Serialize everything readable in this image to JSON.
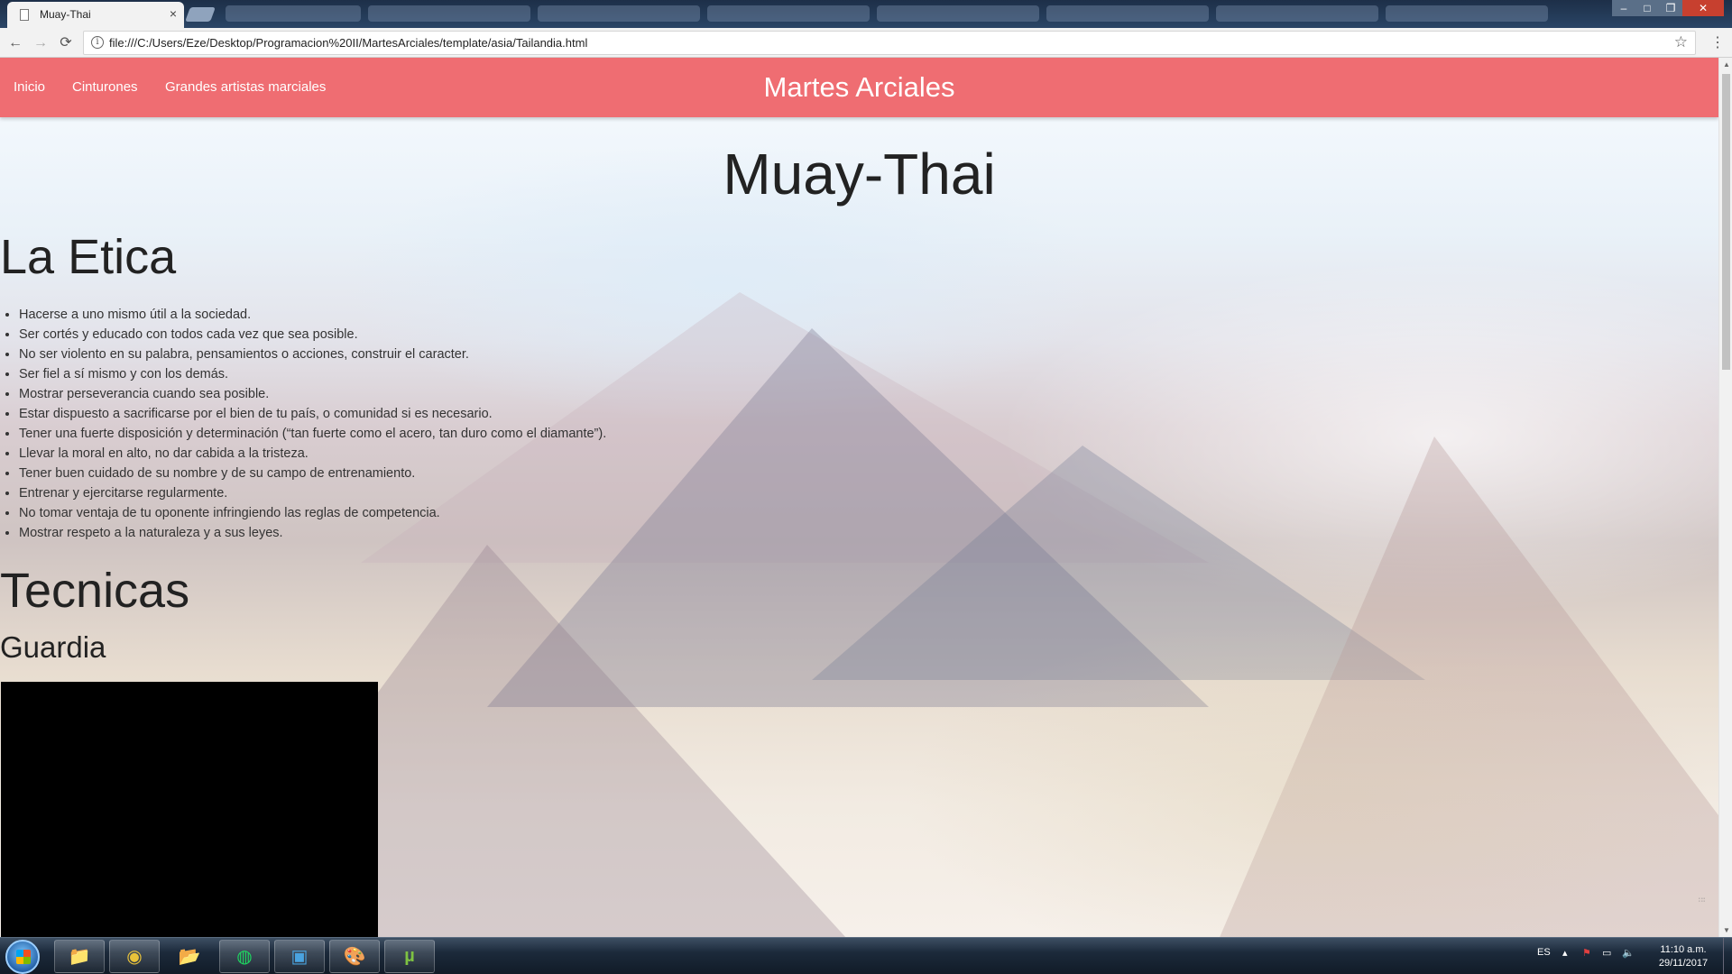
{
  "browser": {
    "tab_title": "Muay-Thai",
    "tab_close": "×",
    "url": "file:///C:/Users/Eze/Desktop/Programacion%20II/MartesArciales/template/asia/Tailandia.html",
    "back": "←",
    "forward": "→",
    "reload": "⟳",
    "info": "i",
    "star": "☆",
    "menu": "⋮",
    "window": {
      "minimize": "–",
      "maximize": "□",
      "restore": "❐",
      "close": "✕"
    }
  },
  "site": {
    "nav": {
      "items": [
        "Inicio",
        "Cinturones",
        "Grandes artistas marciales"
      ],
      "brand": "Martes Arciales",
      "background": "#ef6d72"
    },
    "title": "Muay-Thai",
    "ethics": {
      "heading": "La Etica",
      "items": [
        "Hacerse a uno mismo útil a la sociedad.",
        "Ser cortés y educado con todos cada vez que sea posible.",
        "No ser violento en su palabra, pensamientos o acciones, construir el caracter.",
        "Ser fiel a sí mismo y con los demás.",
        "Mostrar perseverancia cuando sea posible.",
        "Estar dispuesto a sacrificarse por el bien de tu país, o comunidad si es necesario.",
        "Tener una fuerte disposición y determinación (“tan fuerte como el acero, tan duro como el diamante”).",
        "Llevar la moral en alto, no dar cabida a la tristeza.",
        "Tener buen cuidado de su nombre y de su campo de entrenamiento.",
        "Entrenar y ejercitarse regularmente.",
        "No tomar ventaja de tu oponente infringiendo las reglas de competencia.",
        "Mostrar respeto a la naturaleza y a sus leyes."
      ]
    },
    "techniques": {
      "heading": "Tecnicas",
      "subheading": "Guardia"
    }
  },
  "taskbar": {
    "apps": [
      {
        "icon": "file-explorer-icon",
        "glyph": "📁"
      },
      {
        "icon": "chrome-icon",
        "glyph": "◉"
      },
      {
        "icon": "folder-icon",
        "glyph": "📂"
      },
      {
        "icon": "spotify-icon",
        "glyph": "◍"
      },
      {
        "icon": "sublime-icon",
        "glyph": "▣"
      },
      {
        "icon": "paint-icon",
        "glyph": "🎨"
      },
      {
        "icon": "utorrent-icon",
        "glyph": "µ"
      }
    ],
    "language": "ES",
    "time": "11:10 a.m.",
    "date": "29/11/2017"
  }
}
